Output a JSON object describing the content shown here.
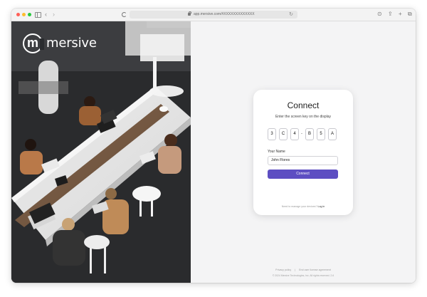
{
  "browser": {
    "url": "app.mersive.com/#XXXXXXXXXXXXX",
    "icons": {
      "sidebar": "sidebar-icon",
      "back": "chevron-left-icon",
      "forward": "chevron-right-icon",
      "page_settings": "page-settings-icon",
      "lock": "lock-icon",
      "reload": "reload-icon",
      "downloads": "download-icon",
      "share": "share-icon",
      "new_tab": "plus-icon",
      "tabs_overview": "tabs-icon"
    }
  },
  "brand": {
    "name": "mersive",
    "logo": "mersive-logo-icon"
  },
  "connect_card": {
    "title": "Connect",
    "subtitle": "Enter the screen key on the display",
    "screen_key": [
      "3",
      "C",
      "4",
      "B",
      "5",
      "A"
    ],
    "separator": "-",
    "name_label": "Your Name",
    "name_value": "John Flores",
    "connect_label": "Connect",
    "manage_prefix": "Need to manage your devices?",
    "manage_link": "Log in"
  },
  "footer": {
    "privacy_policy": "Privacy policy",
    "separator": "|",
    "license_agreement": "End user license agreement",
    "copyright": "© 2024 Mersive Technologies, Inc. All rights reserved. 2.6"
  },
  "colors": {
    "accent": "#5d4ec2",
    "page_background": "#f4f4f5",
    "card_background": "#ffffff"
  }
}
